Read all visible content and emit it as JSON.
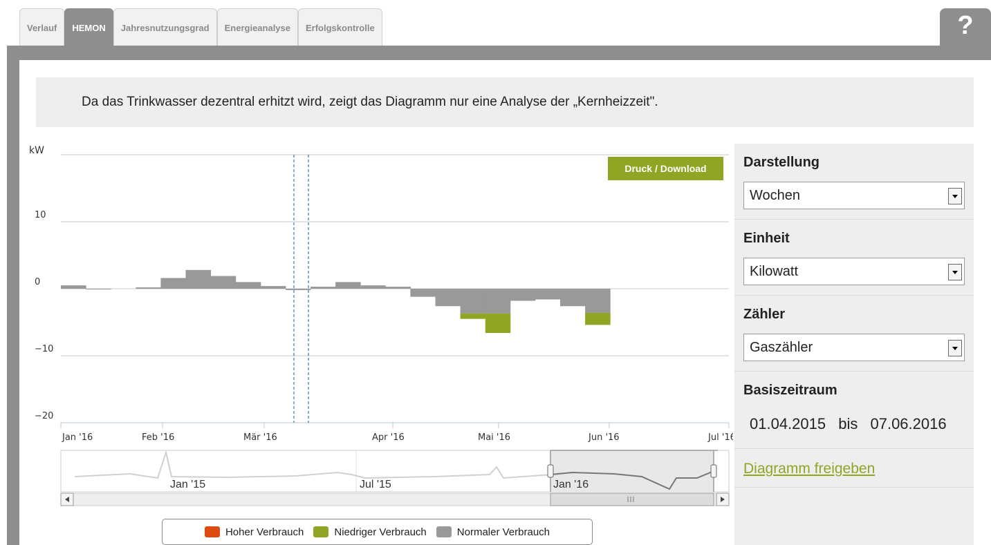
{
  "tabs": [
    {
      "label": "Verlauf",
      "active": false
    },
    {
      "label": "HEMON",
      "active": true
    },
    {
      "label": "Jahresnutzungsgrad",
      "active": false
    },
    {
      "label": "Energieanalyse",
      "active": false
    },
    {
      "label": "Erfolgskontrolle",
      "active": false
    }
  ],
  "help_label": "?",
  "notice": "Da das Trinkwasser dezentral erhitzt wird, zeigt das Diagramm nur eine Analyse der „Kernheizzeit\".",
  "print_button": "Druck / Download",
  "chart_data": {
    "type": "bar",
    "ylabel": "kW",
    "yticks": [
      "10",
      "0",
      "−10",
      "−20"
    ],
    "ylim": [
      -20,
      20
    ],
    "xticks": [
      "Jan '16",
      "Feb '16",
      "Mär '16",
      "Apr '16",
      "Mai '16",
      "Jun '16",
      "Jul '16"
    ],
    "grid": true,
    "series": [
      {
        "name": "Normaler Verbrauch",
        "color": "#999999",
        "values": [
          0.5,
          -0.1,
          0.0,
          0.2,
          1.6,
          2.8,
          1.9,
          1.0,
          0.4,
          -0.2,
          0.3,
          1.0,
          0.5,
          0.3,
          -1.2,
          -2.6,
          -3.7,
          -3.7,
          -1.8,
          -1.6,
          -2.6,
          -3.6
        ]
      },
      {
        "name": "Niedriger Verbrauch",
        "color": "#8ea624",
        "values": [
          0,
          0,
          0,
          0,
          0,
          0,
          0,
          0,
          0,
          0,
          0,
          0,
          0,
          0,
          0,
          0,
          -0.8,
          -2.9,
          0,
          0,
          0,
          -1.8
        ]
      },
      {
        "name": "Hoher Verbrauch",
        "color": "#dd4b10",
        "values": [
          0,
          0,
          0,
          0,
          0,
          0,
          0,
          0,
          0,
          0,
          0,
          0,
          0,
          0,
          0,
          0,
          0,
          0,
          0,
          0,
          0,
          0
        ]
      }
    ],
    "navigator_labels": [
      "Jan '15",
      "Jul '15",
      "Jan '16"
    ]
  },
  "legend": [
    {
      "label": "Hoher Verbrauch",
      "color": "#dd4b10"
    },
    {
      "label": "Niedriger Verbrauch",
      "color": "#8ea624"
    },
    {
      "label": "Normaler Verbrauch",
      "color": "#999999"
    }
  ],
  "sidebar": {
    "darstellung": {
      "title": "Darstellung",
      "value": "Wochen"
    },
    "einheit": {
      "title": "Einheit",
      "value": "Kilowatt"
    },
    "zaehler": {
      "title": "Zähler",
      "value": "Gaszähler"
    },
    "basiszeitraum": {
      "title": "Basiszeitraum",
      "from": "01.04.2015",
      "sep": "bis",
      "to": "07.06.2016"
    },
    "share_link": "Diagramm freigeben"
  }
}
